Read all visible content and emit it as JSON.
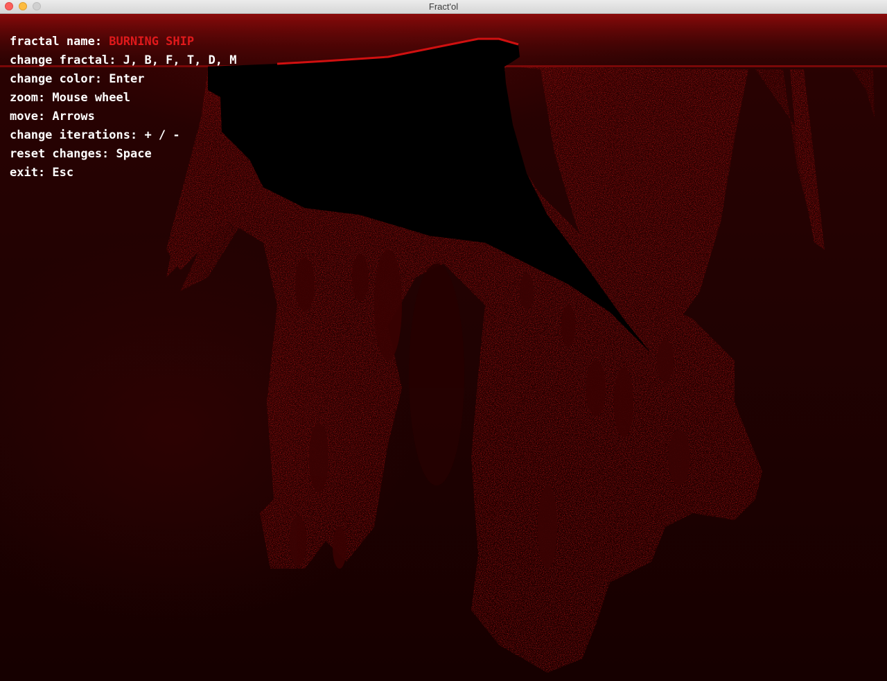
{
  "window": {
    "title": "Fract'ol"
  },
  "help": {
    "fractal_name_label": "fractal name: ",
    "fractal_name_value": "BURNING SHIP",
    "change_fractal": "change fractal: J, B, F, T, D, M",
    "change_color": "change color: Enter",
    "zoom": "zoom: Mouse wheel",
    "move": "move: Arrows",
    "change_iterations": "change iterations: + / -",
    "reset_changes": "reset changes: Space",
    "exit": "exit: Esc"
  },
  "colors": {
    "accent": "#e0191b",
    "fractal_red": "#b01010",
    "background": "#1c0202",
    "interior": "#000000"
  }
}
